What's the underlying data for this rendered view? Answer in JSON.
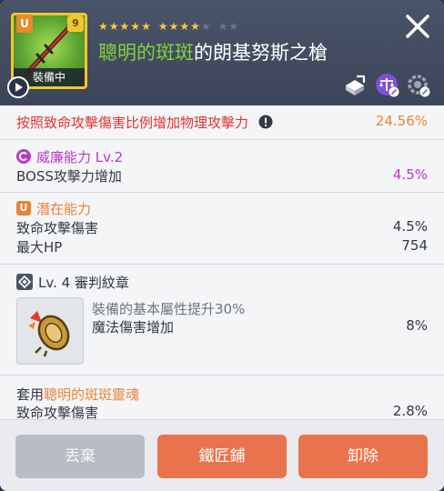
{
  "header": {
    "item_icon": "spear-weapon-icon",
    "badge_u": "U",
    "item_level": "9",
    "equipped_label": "裝備中",
    "stars_filled_group1": 5,
    "stars_filled_group2": 4,
    "stars_empty": 2,
    "title_highlight": "聰明的斑斑",
    "title_rest": "的朗基努斯之槍",
    "close_icon": "close-icon",
    "actions": [
      "share-icon",
      "compare-scale-icon",
      "settings-locked-icon"
    ]
  },
  "main_stat": {
    "label": "按照致命攻擊傷害比例增加物理攻擊力",
    "value": "24.56%"
  },
  "awakening": {
    "title": "威廉能力 Lv.2",
    "stat_label": "BOSS攻擊力增加",
    "stat_value": "4.5%"
  },
  "potential": {
    "badge": "U",
    "title": "潛在能力",
    "stats": [
      {
        "label": "致命攻擊傷害",
        "value": "4.5%"
      },
      {
        "label": "最大HP",
        "value": "754"
      }
    ]
  },
  "emblem": {
    "title": "Lv. 4 審判紋章",
    "desc": "裝備的基本屬性提升30%",
    "stat_label": "魔法傷害增加",
    "stat_value": "8%"
  },
  "set_bonus": {
    "prefix": "套用",
    "name": "聰明的斑斑靈魂",
    "stat_label": "致命攻擊傷害",
    "stat_value": "2.8%"
  },
  "footer": {
    "discard": "丟棄",
    "blacksmith": "鐵匠鋪",
    "unequip": "卸除"
  },
  "colors": {
    "header_bg": "#3f4759",
    "highlight_green": "#80d33c",
    "main_red": "#e0342f",
    "value_orange": "#e8833a",
    "purple": "#b938c9",
    "accent_orange": "#e9734c"
  }
}
